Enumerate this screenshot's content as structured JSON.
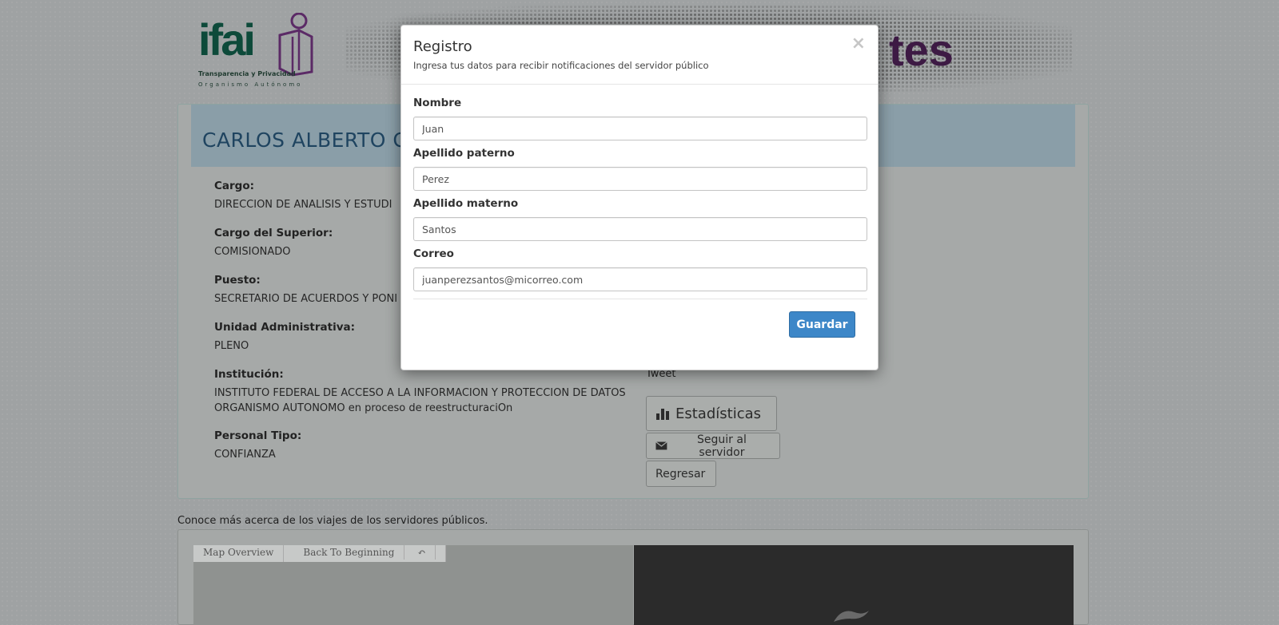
{
  "header": {
    "logo_text": "ifai",
    "logo_tagline": "Transparencia y Privacidad",
    "logo_subtitle": "Organismo  Autónomo",
    "brand_word_partial": "tes"
  },
  "server": {
    "name_partial": "CARLOS ALBERTO G.",
    "fields": [
      {
        "label": "Cargo:",
        "value": "DIRECCION DE ANALISIS Y ESTUDI"
      },
      {
        "label": "Cargo del Superior:",
        "value": "COMISIONADO"
      },
      {
        "label": "Puesto:",
        "value": "SECRETARIO DE ACUERDOS Y PONI"
      },
      {
        "label": "Unidad Administrativa:",
        "value": "PLENO"
      },
      {
        "label": "Institución:",
        "value": "INSTITUTO FEDERAL DE ACCESO A LA INFORMACION Y PROTECCION DE DATOS ORGANISMO AUTONOMO en proceso de reestructuraciOn"
      },
      {
        "label": "Personal Tipo:",
        "value": "CONFIANZA"
      }
    ]
  },
  "actions": {
    "tweet": "Tweet",
    "stats": "Estadísticas",
    "follow": "Seguir al servidor",
    "back": "Regresar"
  },
  "travel_text": "Conoce más acerca de los viajes de los servidores públicos.",
  "map": {
    "overview": "Map Overview",
    "back_to_beginning": "Back To Beginning"
  },
  "modal": {
    "title": "Registro",
    "subtitle": "Ingresa tus datos para recibir notificaciones del servidor público",
    "close": "×",
    "fields": [
      {
        "label": "Nombre",
        "value": "Juan"
      },
      {
        "label": "Apellido paterno",
        "value": "Perez"
      },
      {
        "label": "Apellido materno",
        "value": "Santos"
      },
      {
        "label": "Correo",
        "value": "juanperezsantos@micorreo.com"
      }
    ],
    "save": "Guardar"
  }
}
